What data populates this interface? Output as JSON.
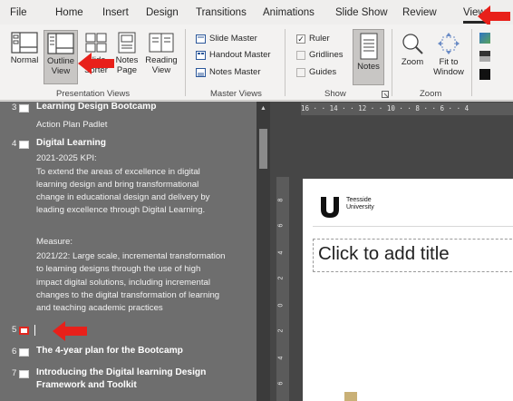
{
  "tabs": [
    {
      "label": "File"
    },
    {
      "label": "Home"
    },
    {
      "label": "Insert"
    },
    {
      "label": "Design"
    },
    {
      "label": "Transitions"
    },
    {
      "label": "Animations"
    },
    {
      "label": "Slide Show"
    },
    {
      "label": "Review"
    },
    {
      "label": "View"
    }
  ],
  "ribbon": {
    "presentation_views": {
      "group_label": "Presentation Views",
      "normal": "Normal",
      "outline": [
        "Outline",
        "View"
      ],
      "sorter": [
        "Slide",
        "Sorter"
      ],
      "notes_page": [
        "Notes",
        "Page"
      ],
      "reading": [
        "Reading",
        "View"
      ]
    },
    "master_views": {
      "group_label": "Master Views",
      "slide_master": "Slide Master",
      "handout_master": "Handout Master",
      "notes_master": "Notes Master"
    },
    "show": {
      "group_label": "Show",
      "ruler": "Ruler",
      "gridlines": "Gridlines",
      "guides": "Guides",
      "notes": "Notes"
    },
    "zoom": {
      "group_label": "Zoom",
      "zoom": "Zoom",
      "fit": [
        "Fit to",
        "Window"
      ]
    }
  },
  "outline": {
    "slide3": {
      "num": "3",
      "title": "Learning Design Bootcamp",
      "lines": [
        "Action Plan Padlet"
      ]
    },
    "slide4": {
      "num": "4",
      "title": "Digital Learning",
      "lines": [
        "2021-2025 KPI:",
        "To extend the areas of excellence in digital",
        "learning design and bring transformational",
        "change in educational design and delivery by",
        "leading excellence through Digital Learning.",
        "",
        "Measure:",
        "2021/22: Large scale, incremental transformation",
        "to learning designs through the use of high",
        "impact digital solutions, including incremental",
        "changes to the digital transformation of learning",
        "and teaching academic practices"
      ]
    },
    "slide5": {
      "num": "5"
    },
    "slide6": {
      "num": "6",
      "title": "The 4-year plan for the Bootcamp"
    },
    "slide7": {
      "num": "7",
      "title_lines": [
        "Introducing the Digital learning Design",
        "Framework and Toolkit"
      ]
    }
  },
  "ruler": {
    "horizontal": "16 · · 14 · · 12 · · 10 · · 8 · · 6 · · 4",
    "vertical": [
      "8",
      "6",
      "4",
      "2",
      "0",
      "2",
      "4",
      "6"
    ]
  },
  "slide": {
    "logo_text": [
      "Teesside",
      "University"
    ],
    "title_placeholder": "Click to add title"
  },
  "colors": {
    "accent_arrow": "#e8201a",
    "outline_bg": "#6e6e6e",
    "ribbon_bg": "#f3f2f1"
  }
}
